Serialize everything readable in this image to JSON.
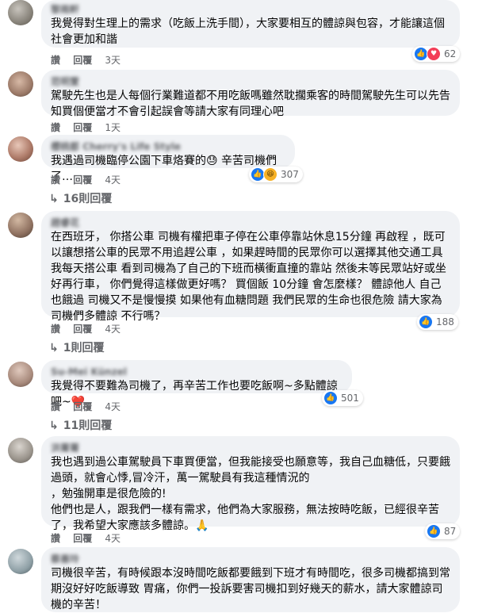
{
  "actions": {
    "like": "讚",
    "reply": "回覆"
  },
  "comments": [
    {
      "author": "黎雨軒",
      "text": "我覺得對生理上的需求（吃飯上洗手間），大家要相互的體諒與包容，才能讓這個社會更加和諧",
      "time": "3天",
      "reactions": "62",
      "reaction_icons": [
        "like-icon",
        "heart-icon"
      ]
    },
    {
      "author": "范明萱",
      "text": "駕駛先生也是人每個行業難道都不用吃飯嗎雖然耽擱乘客的時間駕駛先生可以先告知買個便當才不會引起誤會等請大家有同理心吧",
      "time": "1天"
    },
    {
      "author": "櫻桃都 Cherry's Life Style",
      "text": "我遇過司機臨停公園下車烙賽的😓 辛苦司機們了…",
      "time": "4天",
      "reactions": "307",
      "reaction_icons": [
        "like-icon",
        "haha-icon"
      ],
      "replies": "16則回覆"
    },
    {
      "author": "趙睿花",
      "text": "在西班牙， 你搭公車 司機有權把車子停在公車停靠站休息15分鐘 再啟程 ，既可以讓想搭公車的民眾不用追趕公車 ，如果趕時間的民眾你可以選擇其他交通工具\n我每天搭公車 看到司機為了自己的下班而橫衝直撞的靠站 然後未等民眾站好或坐好再行車， 你們覺得這樣做更好嗎？ 買個飯 10分鐘 會怎麼樣？ 體諒他人 自己也餓過 司機又不是慢慢摸 如果他有血糖問題 我們民眾的生命也很危險 請大家為司機們多體諒 不行嗎？",
      "time": "4天",
      "reactions": "188",
      "reaction_icons": [
        "like-icon"
      ],
      "replies": "1則回覆"
    },
    {
      "author": "Su-Mei Künzel",
      "text": "我覺得不要難為司機了，再辛苦工作也要吃飯啊~多點體諒吧~❤️",
      "time": "4天",
      "reactions": "501",
      "reaction_icons": [
        "like-icon"
      ],
      "replies": "11則回覆"
    },
    {
      "author": "洪菁菁",
      "text": "我也遇到過公車駕駛員下車買便當，但我能接受也願意等，我自己血糖低，只要餓過頭，就會心悸,冒冷汗，萬一駕駛員有我這種情況的\n，勉強開車是很危險的!\n他們也是人，跟我們一樣有需求，他們為大家服務，無法按時吃飯，已經很辛苦了，我希望大家應該多體諒。🙏",
      "time": "4天",
      "reactions": "87",
      "reaction_icons": [
        "like-icon"
      ]
    },
    {
      "author": "蔡善玲",
      "text": "司機很辛苦，有時候跟本沒時間吃飯都要餓到下班才有時間吃，很多司機都搞到常期沒好好吃飯導致 胃痛，你們一投訴要害司機扣到好幾天的薪水，請大家體諒司機的辛苦！"
    }
  ]
}
